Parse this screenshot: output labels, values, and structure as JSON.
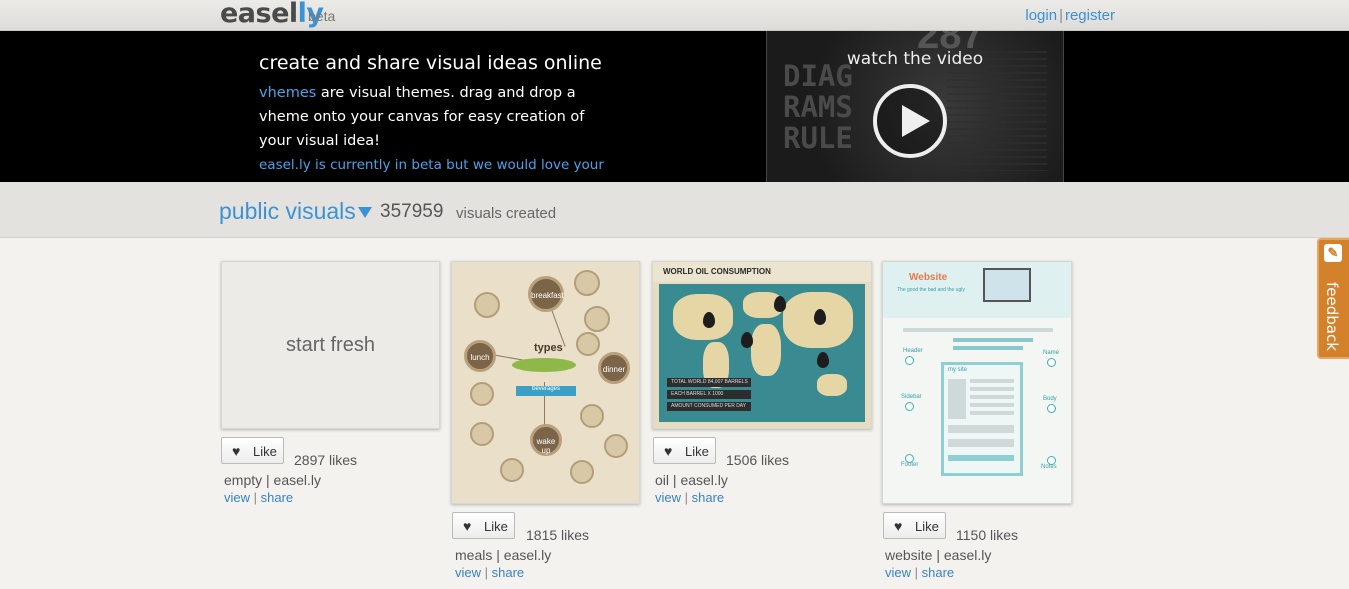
{
  "header": {
    "logo_text_a": "easel",
    "logo_text_b": "ly",
    "beta_label": "beta",
    "login_label": "login",
    "register_label": "register"
  },
  "hero": {
    "title": "create and share visual ideas online",
    "keyword": "vhemes",
    "description": " are visual themes. drag and drop a vheme onto your canvas for easy creation of your visual idea!",
    "beta_note": "easel.ly is currently in beta but we would love your",
    "video_label": "watch the video",
    "video_bg_text": "DIAG\nRAMS\nRULE",
    "video_bg_num": "287"
  },
  "public_visuals": {
    "title": "public visuals",
    "count": "357959",
    "count_label": "visuals created"
  },
  "cards": [
    {
      "thumb_label": "start fresh",
      "like_label": "Like",
      "likes": "2897 likes",
      "name": "empty",
      "owner": "easel.ly",
      "view_label": "view",
      "share_label": "share"
    },
    {
      "thumb_label": "types",
      "like_label": "Like",
      "likes": "1815 likes",
      "name": "meals",
      "owner": "easel.ly",
      "view_label": "view",
      "share_label": "share"
    },
    {
      "thumb_label": "WORLD OIL CONSUMPTION",
      "like_label": "Like",
      "likes": "1506 likes",
      "name": "oil",
      "owner": "easel.ly",
      "view_label": "view",
      "share_label": "share"
    },
    {
      "thumb_label": "Website",
      "like_label": "Like",
      "likes": "1150 likes",
      "name": "website",
      "owner": "easel.ly",
      "view_label": "view",
      "share_label": "share"
    }
  ],
  "meals_thumb": {
    "breakfast": "breakfast",
    "lunch": "lunch",
    "dinner": "dinner",
    "wake_up": "wake up",
    "beverages": "beverages"
  },
  "oil_thumb": {
    "bar1": "TOTAL WORLD 84,007 BARRELS",
    "bar2": "EACH BARREL X 1000",
    "bar3": "AMOUNT CONSUMED PER DAY"
  },
  "website_thumb": {
    "subtitle": "The good the bad and the ugly",
    "header": "Header",
    "sidebar": "Sidebar",
    "footer": "Footer",
    "name": "Name",
    "body": "Body",
    "notes": "Notes",
    "site": "my site"
  },
  "feedback": {
    "label": "feedback"
  },
  "colors": {
    "accent": "#3b93d6",
    "feedback": "#d4812c",
    "hero_bg": "#000000"
  }
}
